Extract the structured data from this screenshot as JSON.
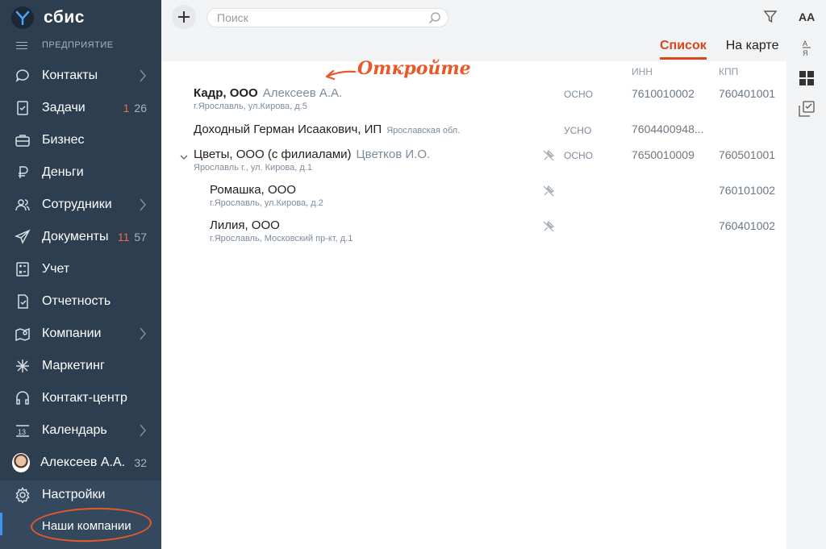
{
  "sidebar": {
    "brand": "сбис",
    "org": "ПРЕДПРИЯТИЕ",
    "items": [
      {
        "label": "Контакты"
      },
      {
        "label": "Задачи",
        "count_red": "1",
        "count": "26"
      },
      {
        "label": "Бизнес"
      },
      {
        "label": "Деньги"
      },
      {
        "label": "Сотрудники"
      },
      {
        "label": "Документы",
        "count_red": "11",
        "count": "57"
      },
      {
        "label": "Учет"
      },
      {
        "label": "Отчетность"
      },
      {
        "label": "Компании"
      },
      {
        "label": "Маркетинг"
      },
      {
        "label": "Контакт-центр"
      },
      {
        "label": "Календарь"
      },
      {
        "label": "Алексеев А.А.",
        "count": "32"
      }
    ],
    "settings_label": "Настройки",
    "sub_item_label": "Наши компании"
  },
  "topbar": {
    "search_placeholder": "Поиск",
    "aa_label": "AA"
  },
  "tabs": [
    {
      "label": "Список",
      "active": true
    },
    {
      "label": "На карте",
      "active": false
    }
  ],
  "columns": {
    "inn": "ИНН",
    "kpp": "КПП"
  },
  "annotation": "Откройте",
  "rows": [
    {
      "name": "Кадр, ООО",
      "person": "Алексеев А.А.",
      "address": "г.Ярославль, ул.Кирова, д.5",
      "tax": "ОСНО",
      "inn": "7610010002",
      "kpp": "760401001"
    },
    {
      "name": "Доходный Герман Исаакович, ИП",
      "region": "Ярославская обл.",
      "tax": "УСНО",
      "inn": "7604400948..."
    },
    {
      "name": "Цветы, ООО (с филиалами)",
      "person": "Цветков И.О.",
      "address": "Ярославль г., ул. Кирова, д.1",
      "tax": "ОСНО",
      "inn": "7650010009",
      "kpp": "760501001"
    },
    {
      "name": "Ромашка, ООО",
      "address": "г.Ярославль, ул.Кирова, д.2",
      "kpp": "760101002"
    },
    {
      "name": "Лилия, ООО",
      "address": "г.Ярославль, Московский пр-кт, д.1",
      "kpp": "760401002"
    }
  ],
  "colors": {
    "sidebar": "#2c3e50",
    "accent": "#d8471c",
    "active_bar": "#3d95ee"
  }
}
